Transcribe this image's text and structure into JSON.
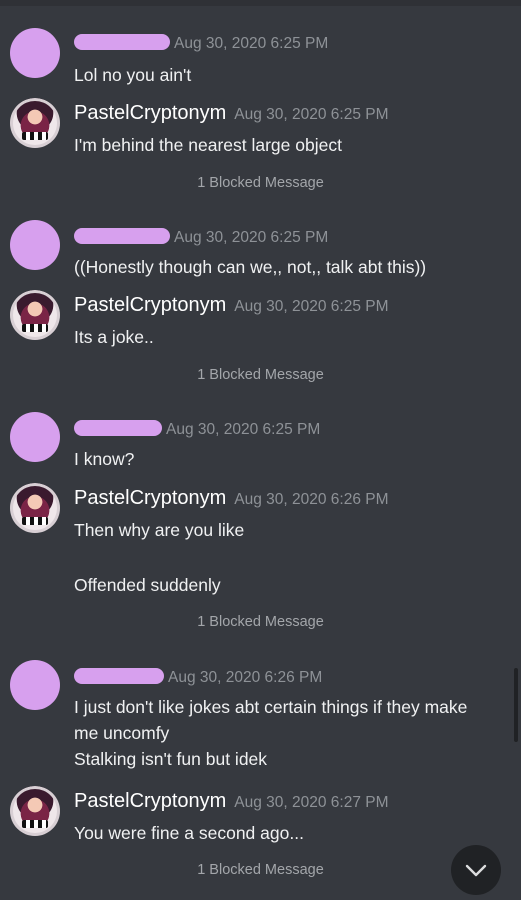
{
  "messages": [
    {
      "author": "",
      "timestamp": "Aug 30, 2020 6:25 PM",
      "lines": [
        "Lol no you ain't"
      ]
    },
    {
      "author": "PastelCryptonym",
      "timestamp": "Aug 30, 2020 6:25 PM",
      "lines": [
        "I'm behind the nearest large object"
      ]
    },
    {
      "author": "",
      "timestamp": "Aug 30, 2020 6:25 PM",
      "lines": [
        "((Honestly though can we,, not,, talk abt this))"
      ]
    },
    {
      "author": "PastelCryptonym",
      "timestamp": "Aug 30, 2020 6:25 PM",
      "lines": [
        "Its a joke.."
      ]
    },
    {
      "author": "",
      "timestamp": "Aug 30, 2020 6:25 PM",
      "lines": [
        "I know?"
      ]
    },
    {
      "author": "PastelCryptonym",
      "timestamp": "Aug 30, 2020 6:26 PM",
      "lines": [
        "Then why are you like",
        "",
        "Offended suddenly"
      ]
    },
    {
      "author": "",
      "timestamp": "Aug 30, 2020 6:26 PM",
      "lines": [
        "I just don't like jokes abt certain things if they make",
        "me uncomfy",
        "Stalking isn't fun but idek"
      ]
    },
    {
      "author": "PastelCryptonym",
      "timestamp": "Aug 30, 2020 6:27 PM",
      "lines": [
        "You were fine a second ago..."
      ]
    }
  ],
  "blocked_label": "1 Blocked Message",
  "icons": {
    "jump": "chevron-down-icon"
  },
  "colors": {
    "background": "#36393f",
    "redaction": "#d7a0ee",
    "timestamp": "#8e9297"
  }
}
